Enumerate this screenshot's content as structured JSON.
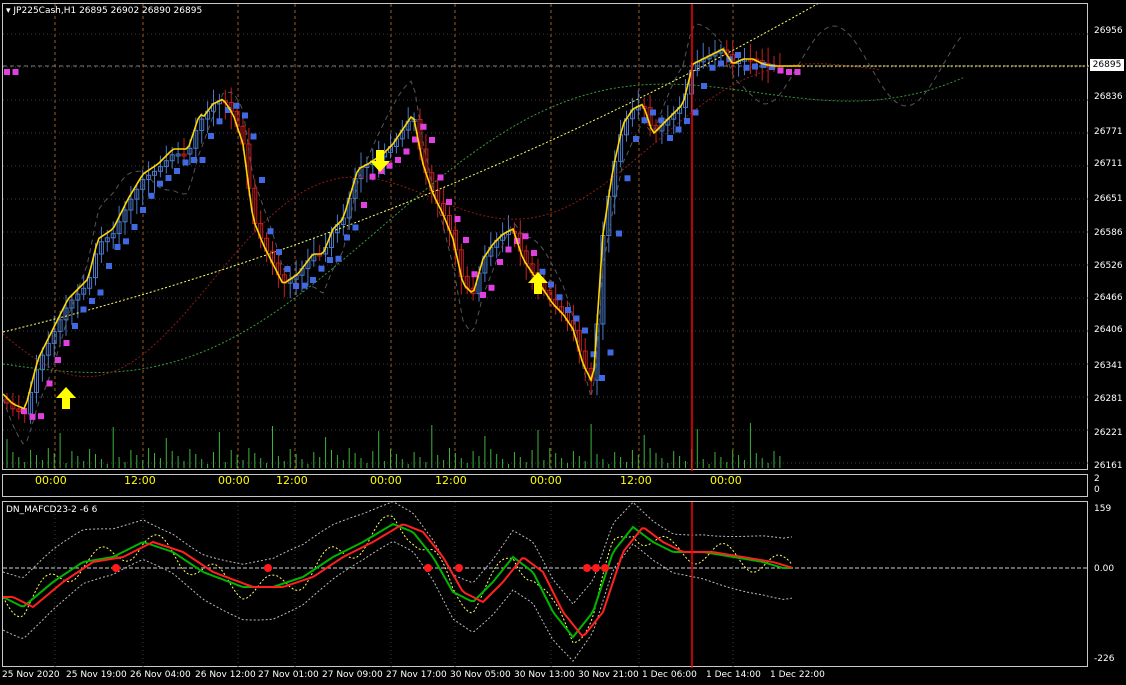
{
  "main_title": "JP225Cash,H1  26895 26902 26890 26895",
  "indicator_title": "DN_MAFCD23-2 -6 6",
  "price_tag": "26895",
  "price_axis": [
    "26956",
    "26895",
    "26836",
    "26771",
    "26711",
    "26651",
    "26586",
    "26526",
    "26466",
    "26406",
    "26341",
    "26281",
    "26221",
    "26161"
  ],
  "session_labels": [
    "00:00",
    "12:00",
    "00:00",
    "12:00",
    "00:00",
    "12:00",
    "00:00",
    "12:00",
    "00:00"
  ],
  "separator_scale": [
    "2",
    "0"
  ],
  "indicator_axis": [
    "159",
    "0.00",
    "-226"
  ],
  "indicator_zero": "0.00",
  "date_axis": [
    "25 Nov 2020",
    "25 Nov 19:00",
    "26 Nov 04:00",
    "26 Nov 12:00",
    "27 Nov 01:00",
    "27 Nov 09:00",
    "27 Nov 17:00",
    "30 Nov 05:00",
    "30 Nov 13:00",
    "30 Nov 21:00",
    "1 Dec 06:00",
    "1 Dec 14:00",
    "1 Dec 22:00"
  ],
  "colors": {
    "background": "#000000",
    "bull_candle": "#4a78c8",
    "bear_candle": "#c81e1e",
    "step_ma_up": "#4169e1",
    "step_ma_down": "#e040e0",
    "yellow_ma": "#ffd700",
    "signal_arrow": "#ffff00",
    "volume": "#3cb43c",
    "cursor_line": "#ff0000",
    "osc_fast": "#00b400",
    "osc_slow": "#ff2020"
  },
  "icons": [
    "dropdown-triangle-icon",
    "arrow-up-icon",
    "arrow-down-icon",
    "signal-dot-icon"
  ]
}
